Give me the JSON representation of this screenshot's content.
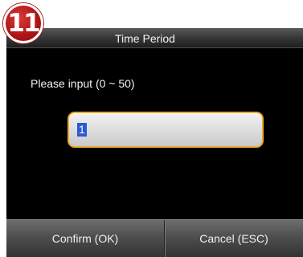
{
  "step_badge": "11",
  "dialog": {
    "title": "Time Period",
    "prompt": "Please input (0 ~ 50)",
    "input_value": "1"
  },
  "buttons": {
    "confirm_label": "Confirm (OK)",
    "cancel_label": "Cancel (ESC)"
  },
  "colors": {
    "screen_background": "#000000",
    "input_border_accent": "#e8a92a",
    "text_selection": "#2a5bd0",
    "badge_red": "#b01616"
  }
}
